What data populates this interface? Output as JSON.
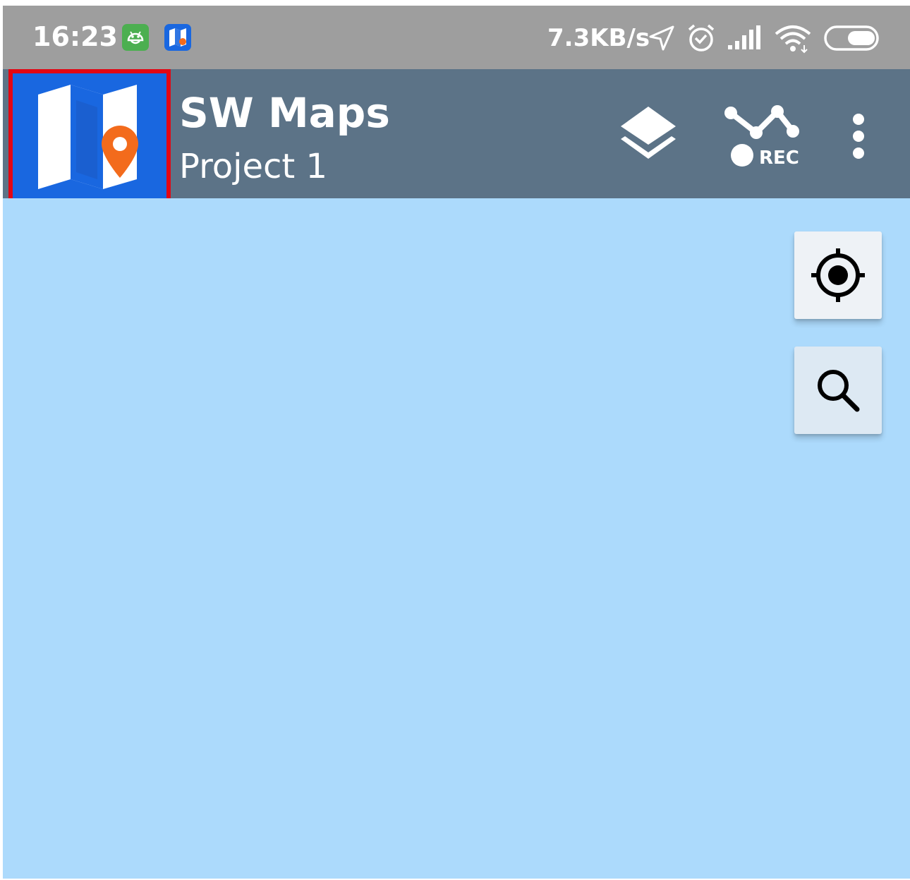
{
  "status_bar": {
    "time": "16:23",
    "network_speed": "7.3KB/s",
    "notification_icons": [
      "android-icon",
      "sw-maps-notification-icon"
    ],
    "system_icons": [
      "location-arrow-icon",
      "alarm-icon",
      "signal-icon",
      "wifi-icon",
      "battery-icon"
    ]
  },
  "app_bar": {
    "title": "SW Maps",
    "subtitle": "Project 1",
    "logo_icon": "sw-maps-logo-icon",
    "actions": [
      {
        "name": "layers",
        "icon": "layers-icon"
      },
      {
        "name": "record-track",
        "icon": "rec-track-icon",
        "label": "REC"
      },
      {
        "name": "more-options",
        "icon": "more-vert-icon"
      }
    ]
  },
  "map": {
    "buttons": [
      {
        "name": "my-location",
        "icon": "gps-crosshair-icon"
      },
      {
        "name": "search",
        "icon": "search-icon"
      }
    ]
  },
  "colors": {
    "status_bar": "#9e9e9e",
    "app_bar": "#5c7387",
    "logo_bg": "#1967e0",
    "logo_pin": "#f36b1c",
    "highlight_border": "#e30613",
    "map_bg": "#acdafc"
  }
}
